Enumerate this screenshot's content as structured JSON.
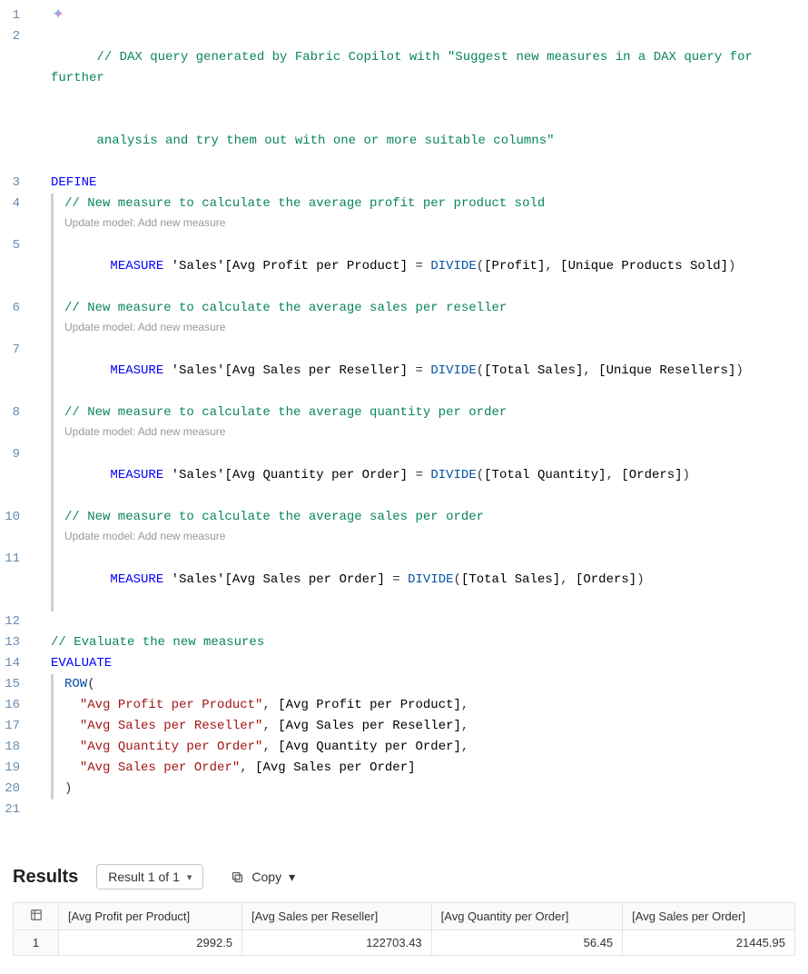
{
  "code": {
    "comment_header_1": "// DAX query generated by Fabric Copilot with \"Suggest new measures in a DAX query for further",
    "comment_header_2": "analysis and try them out with one or more suitable columns\"",
    "define": "DEFINE",
    "m1_comment": "// New measure to calculate the average profit per product sold",
    "codelens": "Update model: Add new measure",
    "m1_prefix": "MEASURE ",
    "m1_table": "'Sales'",
    "m1_name": "[Avg Profit per Product]",
    "eq": " = ",
    "divide": "DIVIDE",
    "m1_a1": "[Profit]",
    "m1_a2": "[Unique Products Sold]",
    "m2_comment": "// New measure to calculate the average sales per reseller",
    "m2_name": "[Avg Sales per Reseller]",
    "m2_a1": "[Total Sales]",
    "m2_a2": "[Unique Resellers]",
    "m3_comment": "// New measure to calculate the average quantity per order",
    "m3_name": "[Avg Quantity per Order]",
    "m3_a1": "[Total Quantity]",
    "m3_a2": "[Orders]",
    "m4_comment": "// New measure to calculate the average sales per order",
    "m4_name": "[Avg Sales per Order]",
    "m4_a1": "[Total Sales]",
    "m4_a2": "[Orders]",
    "eval_comment": "// Evaluate the new measures",
    "evaluate": "EVALUATE",
    "row": "ROW",
    "row_l1_s": "\"Avg Profit per Product\"",
    "row_l1_m": "[Avg Profit per Product]",
    "row_l2_s": "\"Avg Sales per Reseller\"",
    "row_l2_m": "[Avg Sales per Reseller]",
    "row_l3_s": "\"Avg Quantity per Order\"",
    "row_l3_m": "[Avg Quantity per Order]",
    "row_l4_s": "\"Avg Sales per Order\"",
    "row_l4_m": "[Avg Sales per Order]",
    "open_paren": "(",
    "close_paren": ")",
    "comma_sp": ", "
  },
  "lines": [
    "1",
    "2",
    "3",
    "4",
    "5",
    "6",
    "7",
    "8",
    "9",
    "10",
    "11",
    "12",
    "13",
    "14",
    "15",
    "16",
    "17",
    "18",
    "19",
    "20",
    "21"
  ],
  "results": {
    "title": "Results",
    "selector": "Result 1 of 1",
    "copy": "Copy",
    "columns": [
      "[Avg Profit per Product]",
      "[Avg Sales per Reseller]",
      "[Avg Quantity per Order]",
      "[Avg Sales per Order]"
    ],
    "rows": [
      {
        "idx": "1",
        "cells": [
          "2992.5",
          "122703.43",
          "56.45",
          "21445.95"
        ]
      }
    ]
  }
}
